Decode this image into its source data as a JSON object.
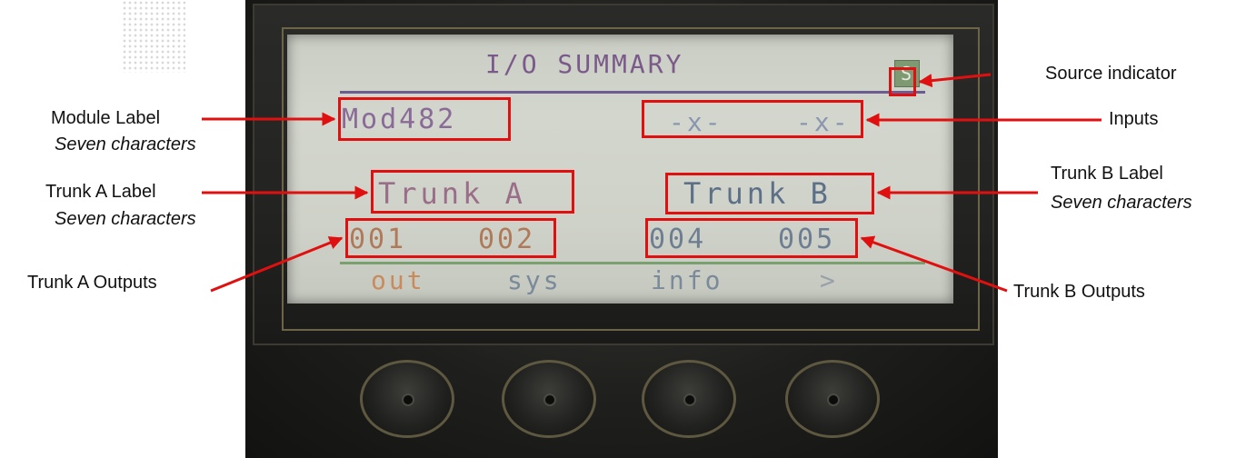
{
  "screen": {
    "title": "I/O SUMMARY",
    "source_indicator": "S",
    "module_label": "Mod482",
    "inputs": [
      "-x-",
      "-x-"
    ],
    "trunk_a_label": "Trunk A",
    "trunk_b_label": "Trunk B",
    "trunk_a_outputs": [
      "001",
      "002"
    ],
    "trunk_b_outputs": [
      "004",
      "005"
    ],
    "softkeys": [
      "out",
      "sys",
      "info",
      ">"
    ]
  },
  "annotations": {
    "source_indicator": "Source indicator",
    "module_label": "Module Label",
    "module_label_note": "Seven characters",
    "inputs": "Inputs",
    "trunk_a_label": "Trunk A Label",
    "trunk_a_label_note": "Seven characters",
    "trunk_b_label": "Trunk B Label",
    "trunk_b_label_note": "Seven characters",
    "trunk_a_outputs": "Trunk A Outputs",
    "trunk_b_outputs": "Trunk B Outputs"
  },
  "colors": {
    "lcd_purple": "#7a5a8a",
    "lcd_blue": "#5d7088",
    "lcd_orange": "#b07a5a",
    "lcd_green": "#7aa070",
    "annotation_red": "#e01010"
  }
}
